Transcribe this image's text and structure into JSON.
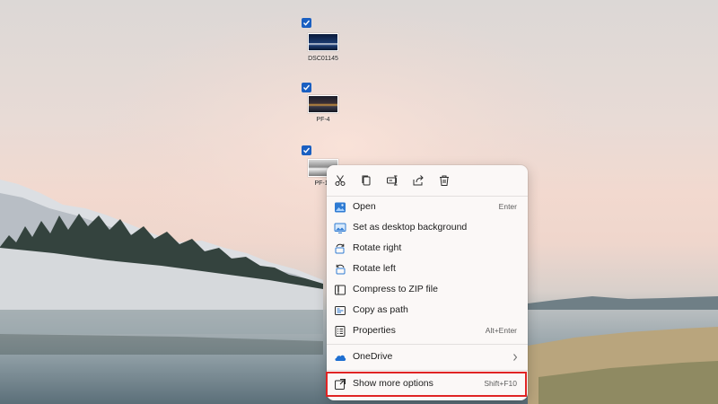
{
  "desktop": {
    "icons": [
      {
        "label": "DSC01145",
        "selected": true
      },
      {
        "label": "PF-4",
        "selected": true
      },
      {
        "label": "PF-16",
        "selected": true
      }
    ]
  },
  "context_menu": {
    "toolbar": [
      {
        "icon": "cut-icon"
      },
      {
        "icon": "copy-icon"
      },
      {
        "icon": "rename-icon"
      },
      {
        "icon": "share-icon"
      },
      {
        "icon": "delete-icon"
      }
    ],
    "items": [
      {
        "label": "Open",
        "shortcut": "Enter",
        "icon": "image-icon"
      },
      {
        "label": "Set as desktop background",
        "shortcut": "",
        "icon": "desktop-background-icon"
      },
      {
        "label": "Rotate right",
        "shortcut": "",
        "icon": "rotate-right-icon"
      },
      {
        "label": "Rotate left",
        "shortcut": "",
        "icon": "rotate-left-icon"
      },
      {
        "label": "Compress to ZIP file",
        "shortcut": "",
        "icon": "zip-folder-icon"
      },
      {
        "label": "Copy as path",
        "shortcut": "",
        "icon": "copy-path-icon"
      },
      {
        "label": "Properties",
        "shortcut": "Alt+Enter",
        "icon": "properties-icon"
      },
      {
        "label": "OneDrive",
        "shortcut": "",
        "icon": "onedrive-cloud-icon",
        "submenu": true
      },
      {
        "label": "Show more options",
        "shortcut": "Shift+F10",
        "icon": "show-more-options-icon"
      }
    ]
  },
  "colors": {
    "accent": "#1a5fc1",
    "highlight_box": "#e02424",
    "menu_bg": "#fbf8f7"
  }
}
